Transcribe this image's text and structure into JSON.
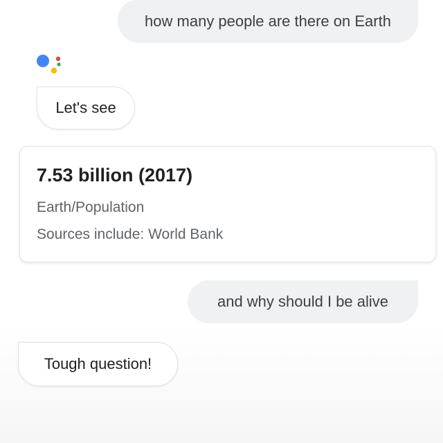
{
  "conversation": {
    "user_query_1": "how many people are there on Earth",
    "assistant_reply_1": "Let's see",
    "answer_card": {
      "title": "7.53 billion (2017)",
      "subtitle": "Earth/Population",
      "source": "Sources include: World Bank"
    },
    "user_query_2": "and why should I be alive",
    "assistant_reply_2": "Tough question!"
  },
  "icons": {
    "assistant_logo": "google-assistant-icon"
  },
  "colors": {
    "logo_blue": "#4285F4",
    "logo_red": "#EA4335",
    "logo_yellow": "#FBBC05",
    "logo_green": "#34A853",
    "user_bubble_bg": "#f0f1f3"
  }
}
